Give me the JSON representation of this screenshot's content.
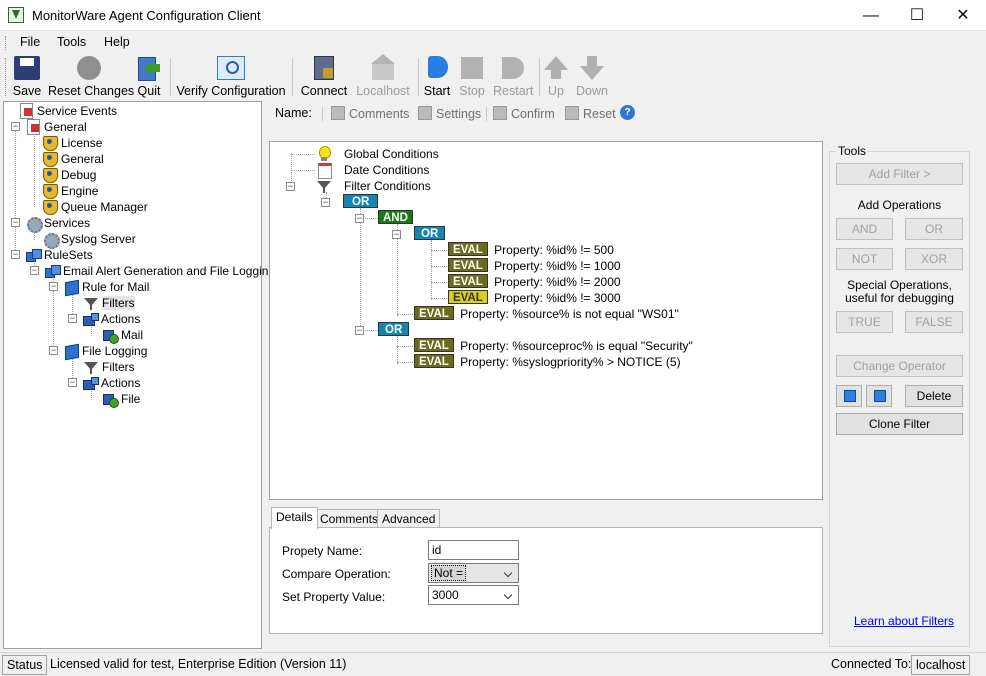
{
  "window": {
    "title": "MonitorWare Agent Configuration Client",
    "controls": {
      "minimize": "—",
      "maximize": "☐",
      "close": "✕"
    }
  },
  "menu": [
    "File",
    "Tools",
    "Help"
  ],
  "toolbar": {
    "save": "Save",
    "reset_changes": "Reset Changes",
    "quit": "Quit",
    "verify": "Verify Configuration",
    "connect": "Connect",
    "localhost": "Localhost",
    "start": "Start",
    "stop": "Stop",
    "restart": "Restart",
    "up": "Up",
    "down": "Down"
  },
  "tree": [
    {
      "label": "Service Events",
      "icon": "document-icon"
    },
    {
      "label": "General",
      "icon": "check-document-icon"
    },
    {
      "label": "License",
      "icon": "shield-icon"
    },
    {
      "label": "General",
      "icon": "shield-icon"
    },
    {
      "label": "Debug",
      "icon": "shield-icon"
    },
    {
      "label": "Engine",
      "icon": "shield-icon"
    },
    {
      "label": "Queue Manager",
      "icon": "shield-icon"
    },
    {
      "label": "Services",
      "icon": "gear-icon"
    },
    {
      "label": "Syslog Server",
      "icon": "gear-icon"
    },
    {
      "label": "RuleSets",
      "icon": "cubes-icon"
    },
    {
      "label": "Email Alert Generation and File Logging",
      "icon": "cubes-icon"
    },
    {
      "label": "Rule for Mail",
      "icon": "cube-icon"
    },
    {
      "label": "Filters",
      "icon": "filter-icon"
    },
    {
      "label": "Actions",
      "icon": "action-icon"
    },
    {
      "label": "Mail",
      "icon": "mail-action-icon"
    },
    {
      "label": "File Logging",
      "icon": "cube-icon"
    },
    {
      "label": "Filters",
      "icon": "filter-icon"
    },
    {
      "label": "Actions",
      "icon": "action-icon"
    },
    {
      "label": "File",
      "icon": "file-action-icon"
    }
  ],
  "subtoolbar": {
    "name_label": "Name:",
    "comments": "Comments",
    "settings": "Settings",
    "confirm": "Confirm",
    "reset": "Reset",
    "help": "?"
  },
  "filter_tree": {
    "global": "Global Conditions",
    "date": "Date Conditions",
    "filter": "Filter Conditions",
    "ops": {
      "or": "OR",
      "and": "AND",
      "eval": "EVAL"
    },
    "conditions": [
      "Property: %id% != 500",
      "Property: %id% != 1000",
      "Property: %id% != 2000",
      "Property: %id% != 3000",
      "Property: %source% is not equal \"WS01\"",
      "Property: %sourceproc% is equal \"Security\"",
      "Property: %syslogpriority% >  NOTICE (5)"
    ]
  },
  "details": {
    "tabs": [
      "Details",
      "Comments",
      "Advanced"
    ],
    "property_name_label": "Propety Name:",
    "property_name_value": "id",
    "compare_label": "Compare Operation:",
    "compare_value": "Not =",
    "set_value_label": "Set Property Value:",
    "set_value_value": "3000"
  },
  "tools": {
    "title": "Tools",
    "add_filter": "Add Filter >",
    "add_operations": "Add Operations",
    "and": "AND",
    "or": "OR",
    "not": "NOT",
    "xor": "XOR",
    "special_line1": "Special Operations,",
    "special_line2": "useful for debugging",
    "true": "TRUE",
    "false": "FALSE",
    "change_operator": "Change Operator",
    "delete": "Delete",
    "clone_filter": "Clone Filter",
    "learn": "Learn about Filters"
  },
  "status": {
    "status_label": "Status",
    "license": "Licensed valid for test, Enterprise Edition (Version 11)",
    "connected_label": "Connected To:",
    "host": "localhost"
  },
  "colors": {
    "or": "#1486b4",
    "and": "#1c7a16",
    "eval": "#6b6b1b",
    "eval_selected": "#d9cf22"
  }
}
